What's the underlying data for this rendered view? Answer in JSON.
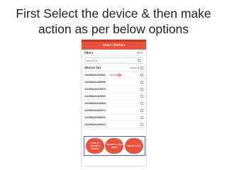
{
  "slide": {
    "title_line1": "First Select the device & then make",
    "title_line2": "action as per below options"
  },
  "app": {
    "header_title": "return devices",
    "filters_label": "filters",
    "filter_value": "all",
    "search_placeholder": "device Id",
    "list_title": "device list",
    "select_all_label": "select all",
    "devices": [
      {
        "id": "111909241464861",
        "checked": true
      },
      {
        "id": "111909241489999",
        "checked": false
      },
      {
        "id": "111909241619575",
        "checked": false
      },
      {
        "id": "111909241929900",
        "checked": false
      },
      {
        "id": "111909241644664",
        "checked": false
      },
      {
        "id": "111909241954970",
        "checked": false
      },
      {
        "id": "111909241954504",
        "checked": false
      },
      {
        "id": "111909241684664",
        "checked": false
      }
    ],
    "actions": [
      {
        "label": "move to allocated devices"
      },
      {
        "label": "transfer to other agent"
      },
      {
        "label": "transfer to Sir"
      }
    ]
  },
  "colors": {
    "header": "#e8533f",
    "status_bar": "#c0392b",
    "annotation": "#d62c2c",
    "actions_border": "#4a5fd0"
  }
}
